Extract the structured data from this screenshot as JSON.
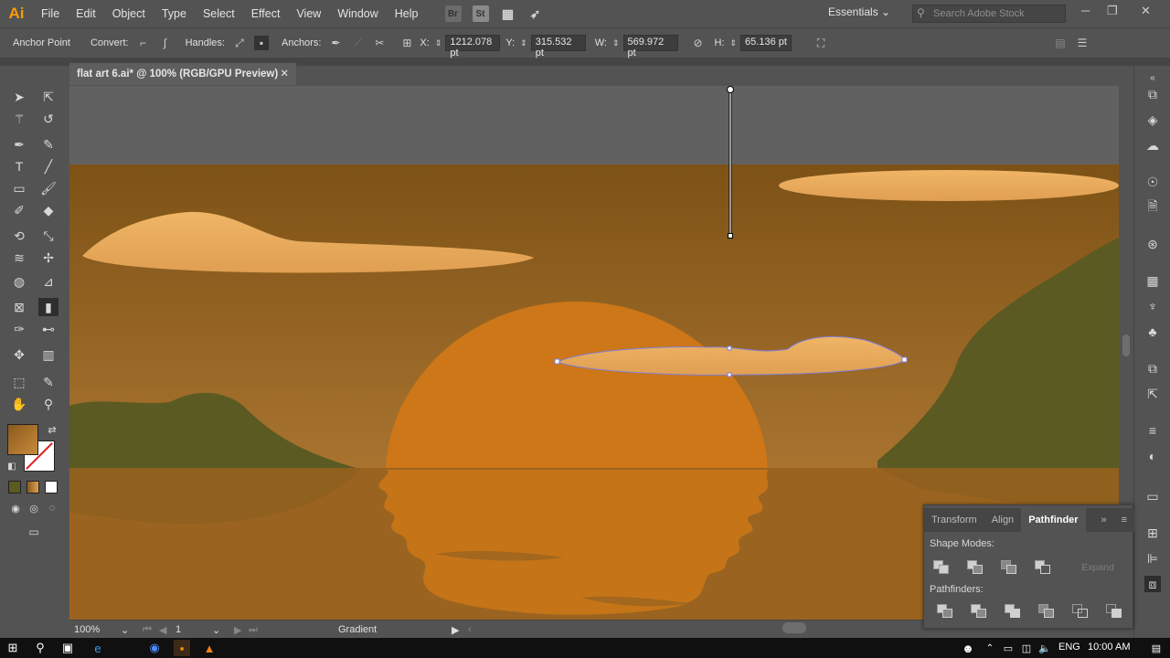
{
  "app": {
    "logo": "Ai"
  },
  "menu": [
    "File",
    "Edit",
    "Object",
    "Type",
    "Select",
    "Effect",
    "View",
    "Window",
    "Help"
  ],
  "menubar_icons": {
    "bridge": "Br",
    "stock": "St"
  },
  "workspace": "Essentials",
  "search": {
    "placeholder": "Search Adobe Stock"
  },
  "control_bar": {
    "anchor_point": "Anchor Point",
    "convert": "Convert:",
    "handles": "Handles:",
    "anchors": "Anchors:",
    "x_label": "X:",
    "x_value": "1212.078 pt",
    "y_label": "Y:",
    "y_value": "315.532 pt",
    "w_label": "W:",
    "w_value": "569.972 pt",
    "h_label": "H:",
    "h_value": "65.136 pt"
  },
  "document": {
    "tab_title": "flat art 6.ai* @ 100% (RGB/GPU Preview)",
    "close": "✕"
  },
  "status": {
    "zoom": "100%",
    "artboard": "1",
    "tool": "Gradient"
  },
  "pathfinder": {
    "tabs": [
      "Transform",
      "Align",
      "Pathfinder"
    ],
    "active_tab": "Pathfinder",
    "shape_modes": "Shape Modes:",
    "pathfinders": "Pathfinders:",
    "expand": "Expand"
  },
  "taskbar": {
    "lang": "ENG",
    "time": "10:00 AM"
  },
  "colors": {
    "sky_top": "#7d5216",
    "sky_bottom": "#b07a35",
    "sun": "#cd7718",
    "cloud": "#e6a85a",
    "hill": "#5a5a22",
    "water": "#9a6420",
    "accent": "#ff9a00"
  }
}
